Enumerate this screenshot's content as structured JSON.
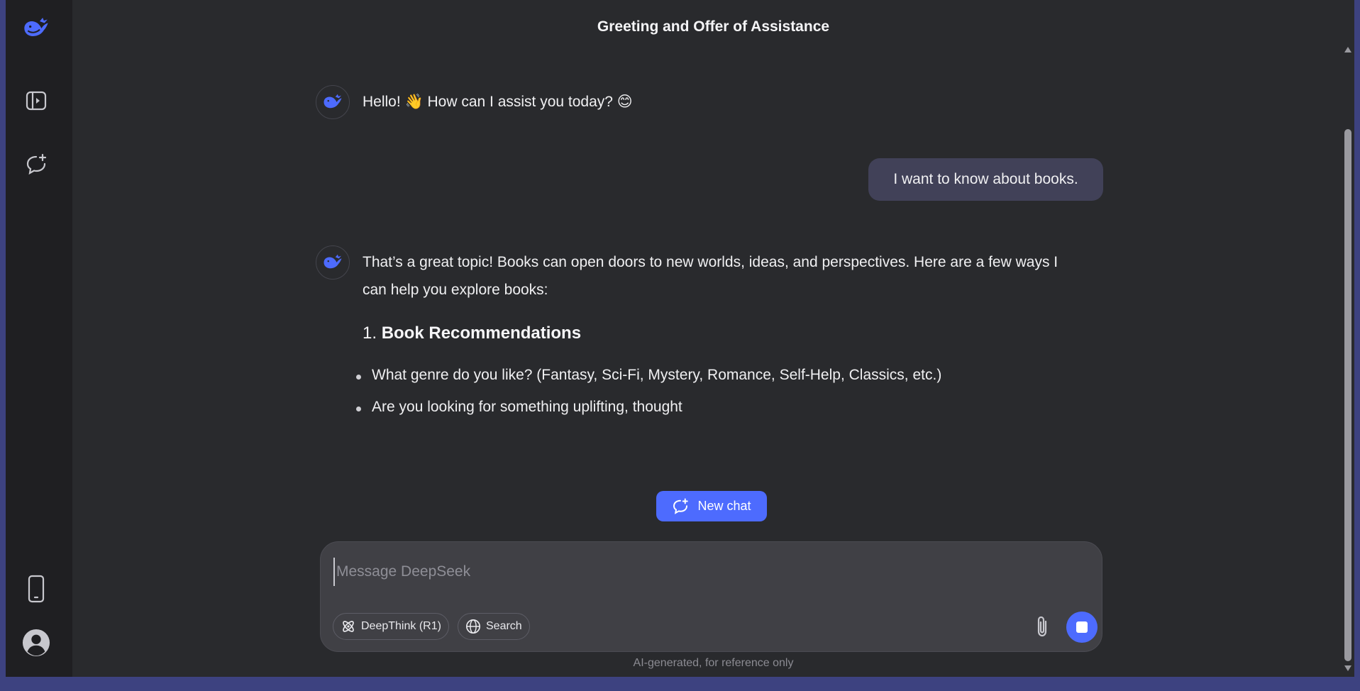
{
  "title": "Greeting and Offer of Assistance",
  "sidebar": {
    "items": [
      {
        "icon": "whale-logo-icon"
      },
      {
        "icon": "expand-sidebar-icon"
      },
      {
        "icon": "new-chat-icon"
      },
      {
        "icon": "mobile-app-icon"
      },
      {
        "icon": "user-profile-icon"
      }
    ]
  },
  "messages": {
    "greeting": "Hello! 👋 How can I assist you today? 😊",
    "user": "I want to know about books.",
    "reply_line1": "That’s a great topic! Books can open doors to new worlds, ideas, and perspectives. Here are a few ways I",
    "reply_line2": "can help you explore books:",
    "heading_num": "1.",
    "heading_text": "Book Recommendations",
    "bullets": [
      "What genre do you like? (Fantasy, Sci-Fi, Mystery, Romance, Self-Help, Classics, etc.)",
      "Are you looking for something uplifting, thought"
    ]
  },
  "new_chat_label": "New chat",
  "composer": {
    "placeholder": "Message DeepSeek",
    "deepthink_label": "DeepThink (R1)",
    "search_label": "Search"
  },
  "disclaimer": "AI-generated, for reference only",
  "colors": {
    "accent": "#4d6bfe",
    "background": "#292a2d",
    "sidebar": "#1f1f22",
    "user_bubble": "#414158"
  }
}
